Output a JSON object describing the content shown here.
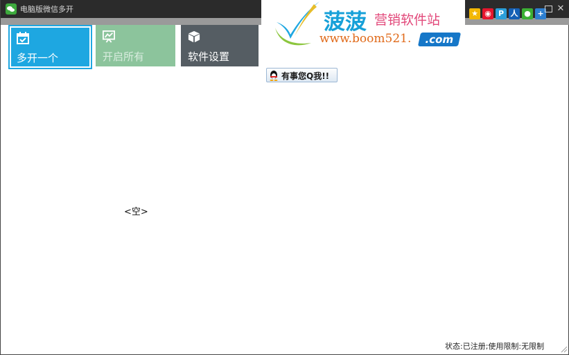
{
  "window": {
    "title": "电脑版微信多开"
  },
  "tiles": [
    {
      "label": "多开一个",
      "icon": "calendar-check-icon",
      "color": "#1ea7e1"
    },
    {
      "label": "开启所有",
      "icon": "presentation-chart-icon",
      "color": "#8cc49c"
    },
    {
      "label": "软件设置",
      "icon": "cube-icon",
      "color": "#555d63"
    }
  ],
  "banner": {
    "brand": "菠菠",
    "subtitle": "营销软件站",
    "url": "www.boom521.",
    "domain": ".com"
  },
  "share_icons": [
    {
      "icon": "qzone-icon",
      "color": "#f2b705"
    },
    {
      "icon": "weibo-icon",
      "color": "#e6162d"
    },
    {
      "icon": "tencent-weibo-icon",
      "color": "#2b9fd9"
    },
    {
      "icon": "renren-icon",
      "color": "#1560b5"
    },
    {
      "icon": "wechat-icon",
      "color": "#3cb034"
    },
    {
      "icon": "more-share-icon",
      "color": "#2d7fd1"
    }
  ],
  "contact": {
    "label": "有事您Q我!!"
  },
  "list": {
    "empty_text": "<空>"
  },
  "status": {
    "text": "状态:已注册;使用限制:无限制"
  },
  "colors": {
    "titlebar": "#2b2b2b",
    "accent": "#1ea7e1"
  }
}
